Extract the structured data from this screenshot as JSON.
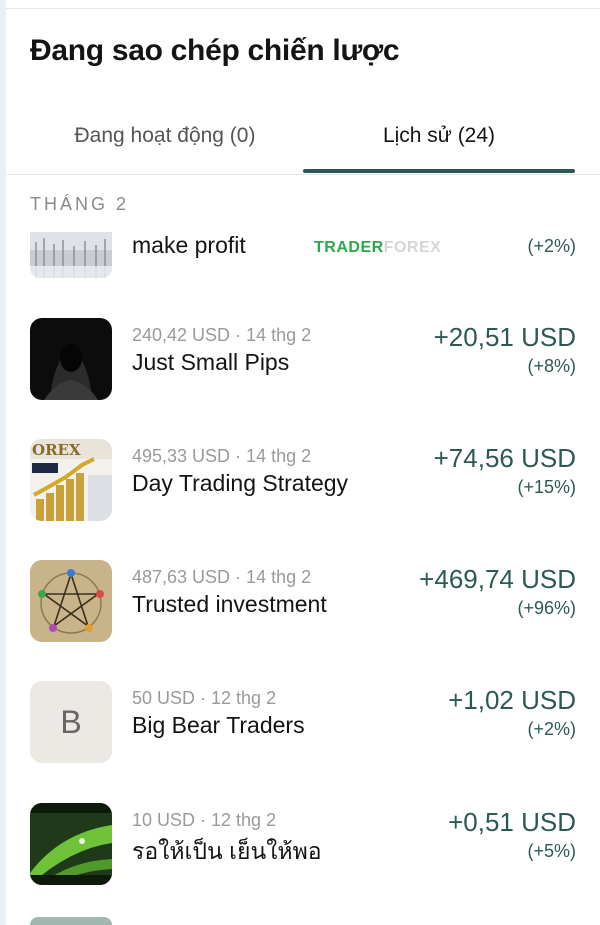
{
  "header": {
    "title": "Đang sao chép chiến lược"
  },
  "tabs": [
    {
      "label": "Đang hoạt động (0)",
      "active": false
    },
    {
      "label": "Lịch sử (24)",
      "active": true
    }
  ],
  "section": {
    "label": "THÁNG 2"
  },
  "watermark": {
    "part_a": "TRADER",
    "part_b": "FOREX"
  },
  "colors": {
    "accent": "#2c5954",
    "tab_indicator": "#2a5a56",
    "muted": "#9a9a9a"
  },
  "strategies": [
    {
      "meta": "",
      "name": "make profit",
      "amount": "",
      "pct": "(+2%)",
      "thumb": "snow-forest-image"
    },
    {
      "meta": "240,42 USD · 14 thg 2",
      "name": "Just Small Pips",
      "amount": "+20,51 USD",
      "pct": "(+8%)",
      "thumb": "hooded-figure-image"
    },
    {
      "meta": "495,33 USD · 14 thg 2",
      "name": "Day Trading Strategy",
      "amount": "+74,56 USD",
      "pct": "(+15%)",
      "thumb": "forex-chart-image"
    },
    {
      "meta": "487,63 USD · 14 thg 2",
      "name": "Trusted investment",
      "amount": "+469,74 USD",
      "pct": "(+96%)",
      "thumb": "pentagram-diagram-image"
    },
    {
      "meta": "50 USD · 12 thg 2",
      "name": "Big Bear Traders",
      "amount": "+1,02 USD",
      "pct": "(+2%)",
      "thumb": "letter-avatar",
      "avatar_letter": "B"
    },
    {
      "meta": "10 USD · 12 thg 2",
      "name": "รอให้เป็น เย็นให้พอ",
      "amount": "+0,51 USD",
      "pct": "(+5%)",
      "thumb": "green-leaf-image"
    }
  ]
}
